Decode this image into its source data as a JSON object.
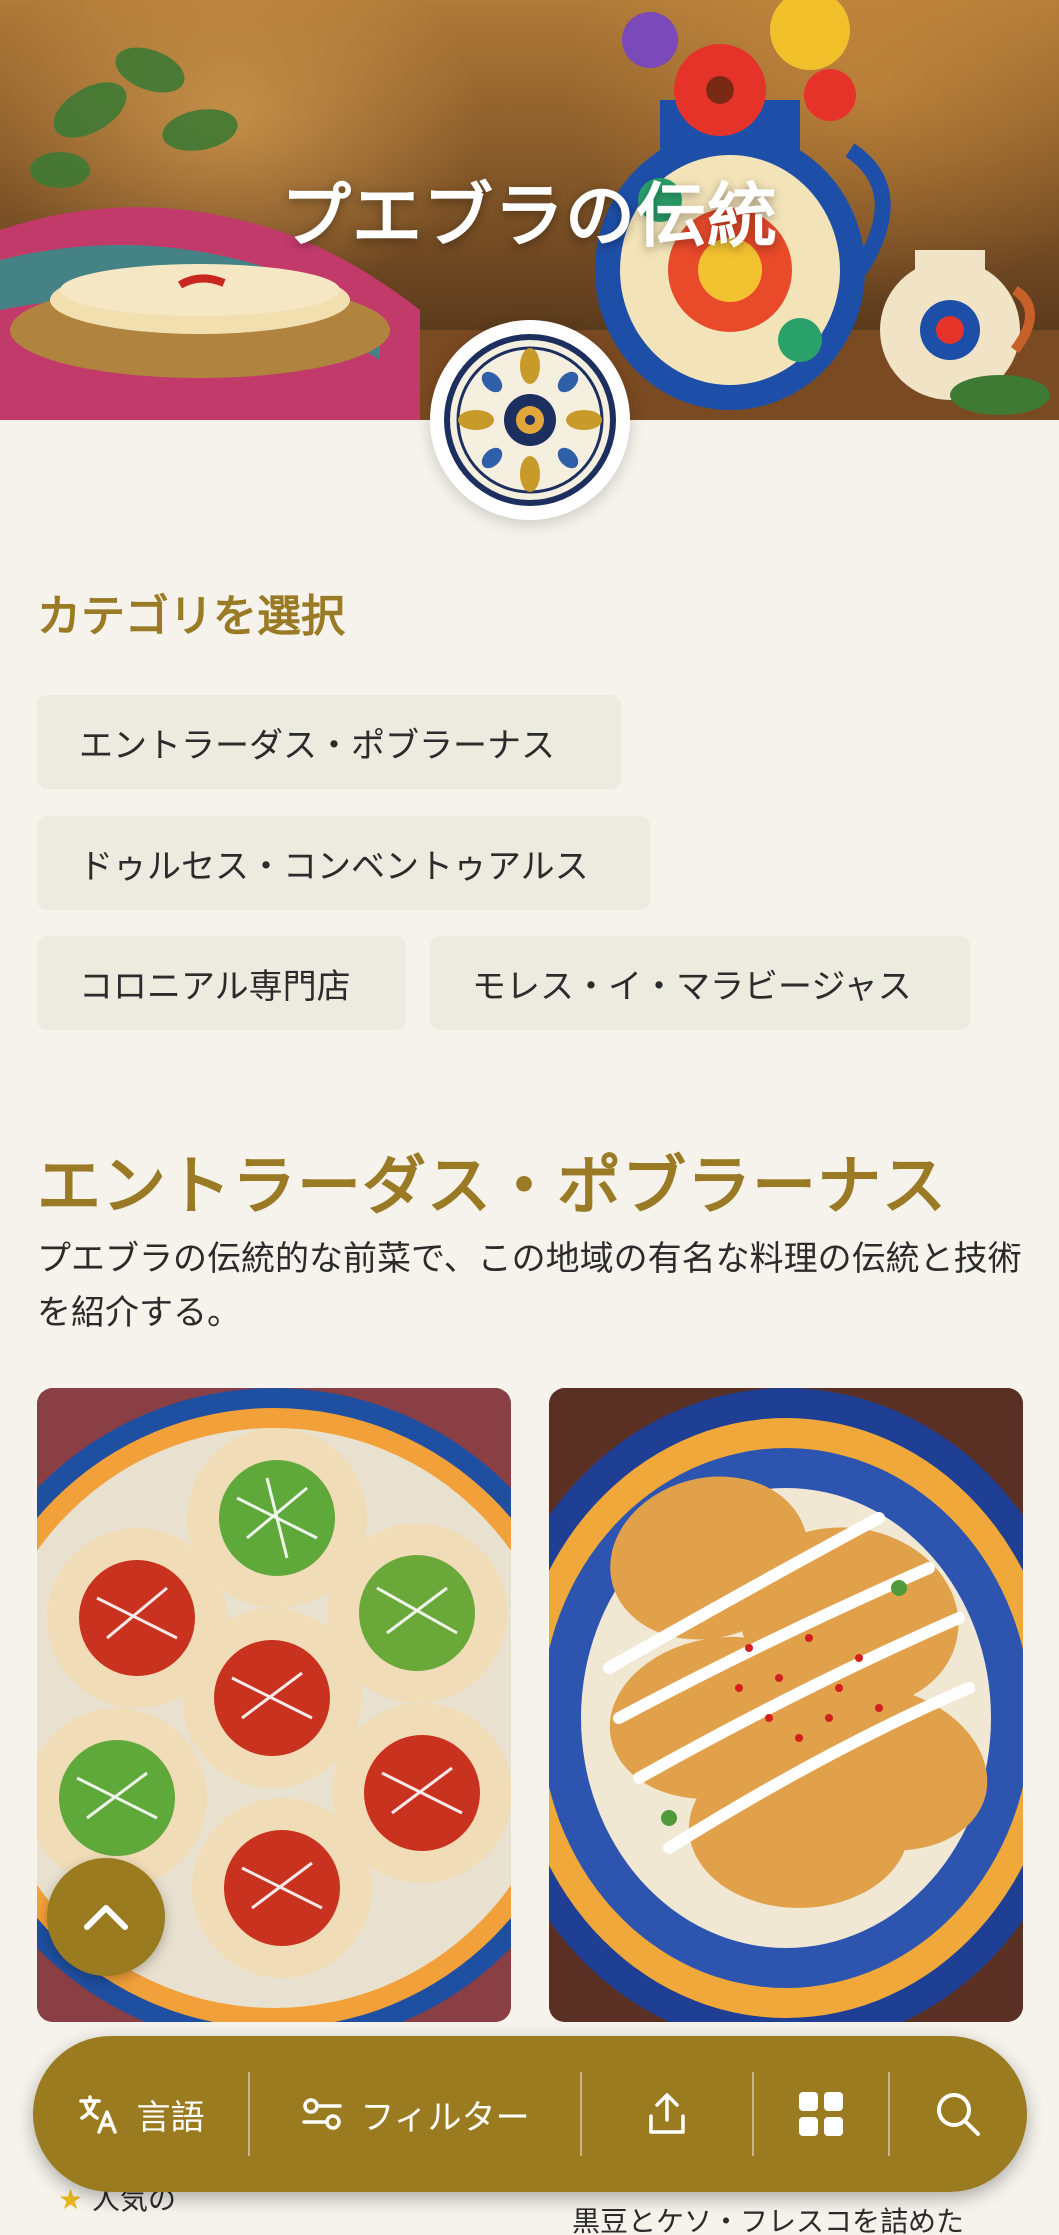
{
  "hero": {
    "title": "プエブラの伝統"
  },
  "categories": {
    "heading": "カテゴリを選択",
    "chips": [
      "エントラーダス・ポブラーナス",
      "ドゥルセス・コンベントゥアルス",
      "コロニアル専門店",
      "モレス・イ・マラビージャス"
    ]
  },
  "section": {
    "title": "エントラーダス・ポブラーナス",
    "description": "プエブラの伝統的な前菜で、この地域の有名な料理の伝統と技術を紹介する。"
  },
  "cards": {
    "left_caption": "人気の",
    "right_caption": "黒豆とケソ・フレスコを詰めた"
  },
  "bottom_nav": {
    "language_label": "言語",
    "filter_label": "フィルター"
  },
  "colors": {
    "accent": "#9b7b1f",
    "heading": "#9a7a24",
    "chip_bg": "#ecebe0",
    "page_bg": "#f6f3ec"
  }
}
